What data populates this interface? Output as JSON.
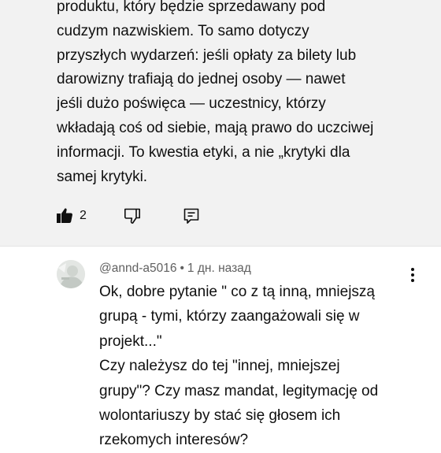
{
  "top_comment": {
    "lines": [
      "produktu, który będzie sprzedawany pod",
      "cudzym nazwiskiem. To samo dotyczy",
      "przyszłych wydarzeń: jeśli opłaty za bilety lub",
      "darowizny trafiają do jednej osoby — nawet",
      "jeśli dużo poświęca — uczestnicy, którzy",
      "wkładają coś od siebie, mają prawo do uczciwej",
      "informacji. To kwestia etyki, a nie „krytyki dla",
      "samej krytyki."
    ],
    "like_count": "2",
    "icons": [
      "thumb-up-icon",
      "thumb-down-icon",
      "reply-icon"
    ]
  },
  "reply": {
    "author": "@annd-a5016",
    "separator": "•",
    "time": "1 дн. назад",
    "lines": [
      "Ok, dobre pytanie \" co z tą inną, mniejszą",
      "grupą - tymi, którzy zaangażowali się w",
      "projekt...\"",
      "Czy należysz do tej \"innej, mniejszej",
      "grupy\"? Czy masz mandat, legitymację od",
      "wolontariuszy by stać się głosem ich",
      "rzekomych interesów?"
    ],
    "icons": [
      "avatar",
      "more-vertical-icon"
    ]
  },
  "colors": {
    "highlight_bg": "#f2f2f2",
    "text": "#0f0f0f",
    "meta": "#606060"
  }
}
